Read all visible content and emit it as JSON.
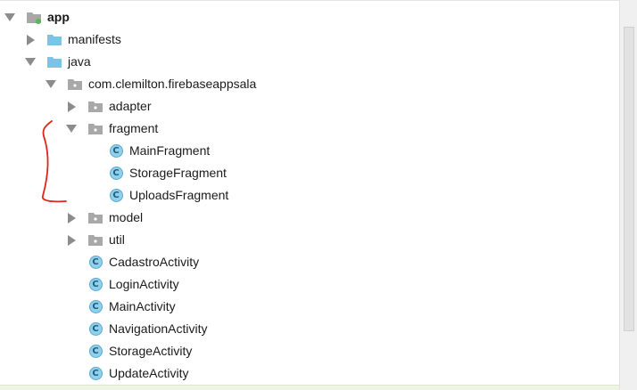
{
  "project_tree": {
    "items": [
      {
        "label": "app",
        "depth": 0,
        "arrow": "expanded",
        "icon": "module",
        "bold": true
      },
      {
        "label": "manifests",
        "depth": 1,
        "arrow": "collapsed",
        "icon": "folder"
      },
      {
        "label": "java",
        "depth": 1,
        "arrow": "expanded",
        "icon": "folder"
      },
      {
        "label": "com.clemilton.firebaseappsala",
        "depth": 2,
        "arrow": "expanded",
        "icon": "package"
      },
      {
        "label": "adapter",
        "depth": 3,
        "arrow": "collapsed",
        "icon": "package"
      },
      {
        "label": "fragment",
        "depth": 3,
        "arrow": "expanded",
        "icon": "package"
      },
      {
        "label": "MainFragment",
        "depth": 4,
        "arrow": "none",
        "icon": "class"
      },
      {
        "label": "StorageFragment",
        "depth": 4,
        "arrow": "none",
        "icon": "class"
      },
      {
        "label": "UploadsFragment",
        "depth": 4,
        "arrow": "none",
        "icon": "class"
      },
      {
        "label": "model",
        "depth": 3,
        "arrow": "collapsed",
        "icon": "package"
      },
      {
        "label": "util",
        "depth": 3,
        "arrow": "collapsed",
        "icon": "package"
      },
      {
        "label": "CadastroActivity",
        "depth": 3,
        "arrow": "none",
        "icon": "class"
      },
      {
        "label": "LoginActivity",
        "depth": 3,
        "arrow": "none",
        "icon": "class"
      },
      {
        "label": "MainActivity",
        "depth": 3,
        "arrow": "none",
        "icon": "class"
      },
      {
        "label": "NavigationActivity",
        "depth": 3,
        "arrow": "none",
        "icon": "class"
      },
      {
        "label": "StorageActivity",
        "depth": 3,
        "arrow": "none",
        "icon": "class"
      },
      {
        "label": "UpdateActivity",
        "depth": 3,
        "arrow": "none",
        "icon": "class"
      }
    ],
    "class_icon_letter": "C"
  },
  "colors": {
    "folder": "#7cc3e8",
    "package": "#a8a8a8",
    "class_icon": "#8fd0ec",
    "module_dot": "#5bb55a",
    "annotation": "#e0251b"
  }
}
